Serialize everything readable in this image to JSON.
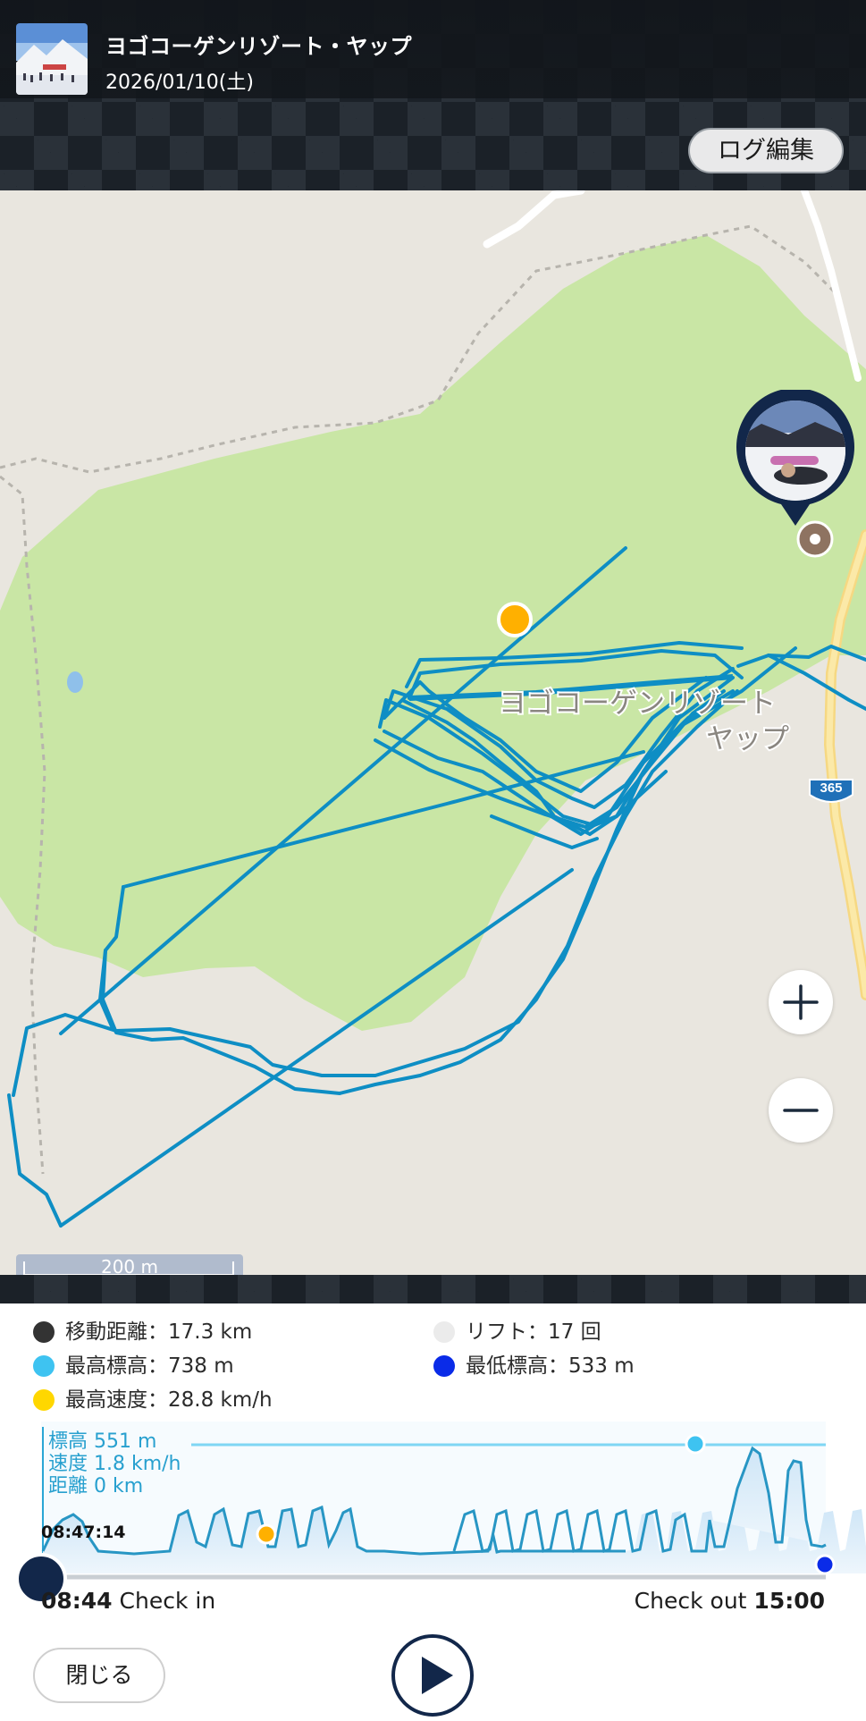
{
  "header": {
    "resort_name": "ヨゴコーゲンリゾート・ヤップ",
    "date": "2026/01/10(土)",
    "log_edit_label": "ログ編集"
  },
  "map": {
    "place_label_line1": "ヨゴコーゲンリゾート",
    "place_label_line2": "ヤップ",
    "road_number": "365",
    "scale_label": "200 m",
    "track_color": "#0e8ec4",
    "forest_color": "#c9e6a5",
    "land_color": "#e9e6df",
    "current_marker_color": "#ffb000"
  },
  "stats": {
    "distance": "移動距離：17.3 km",
    "lift": "リフト：17 回",
    "max_altitude": "最高標高：738 m",
    "min_altitude": "最低標高：533 m",
    "max_speed": "最高速度：28.8 km/h",
    "colors": {
      "distance": "#333333",
      "lift": "#ebebeb",
      "max_altitude": "#3ec3f1",
      "min_altitude": "#0a2be8",
      "max_speed": "#ffd700"
    }
  },
  "graph": {
    "readout_altitude": "標高 551 m",
    "readout_speed": "速度 1.8 km/h",
    "readout_distance": "距離 0 km",
    "cursor_time": "08:47:14",
    "checkin_time": "08:44",
    "checkin_label": "Check in",
    "checkout_label": "Check out",
    "checkout_time": "15:00"
  },
  "controls": {
    "close_label": "閉じる",
    "play_icon": "play-icon"
  }
}
